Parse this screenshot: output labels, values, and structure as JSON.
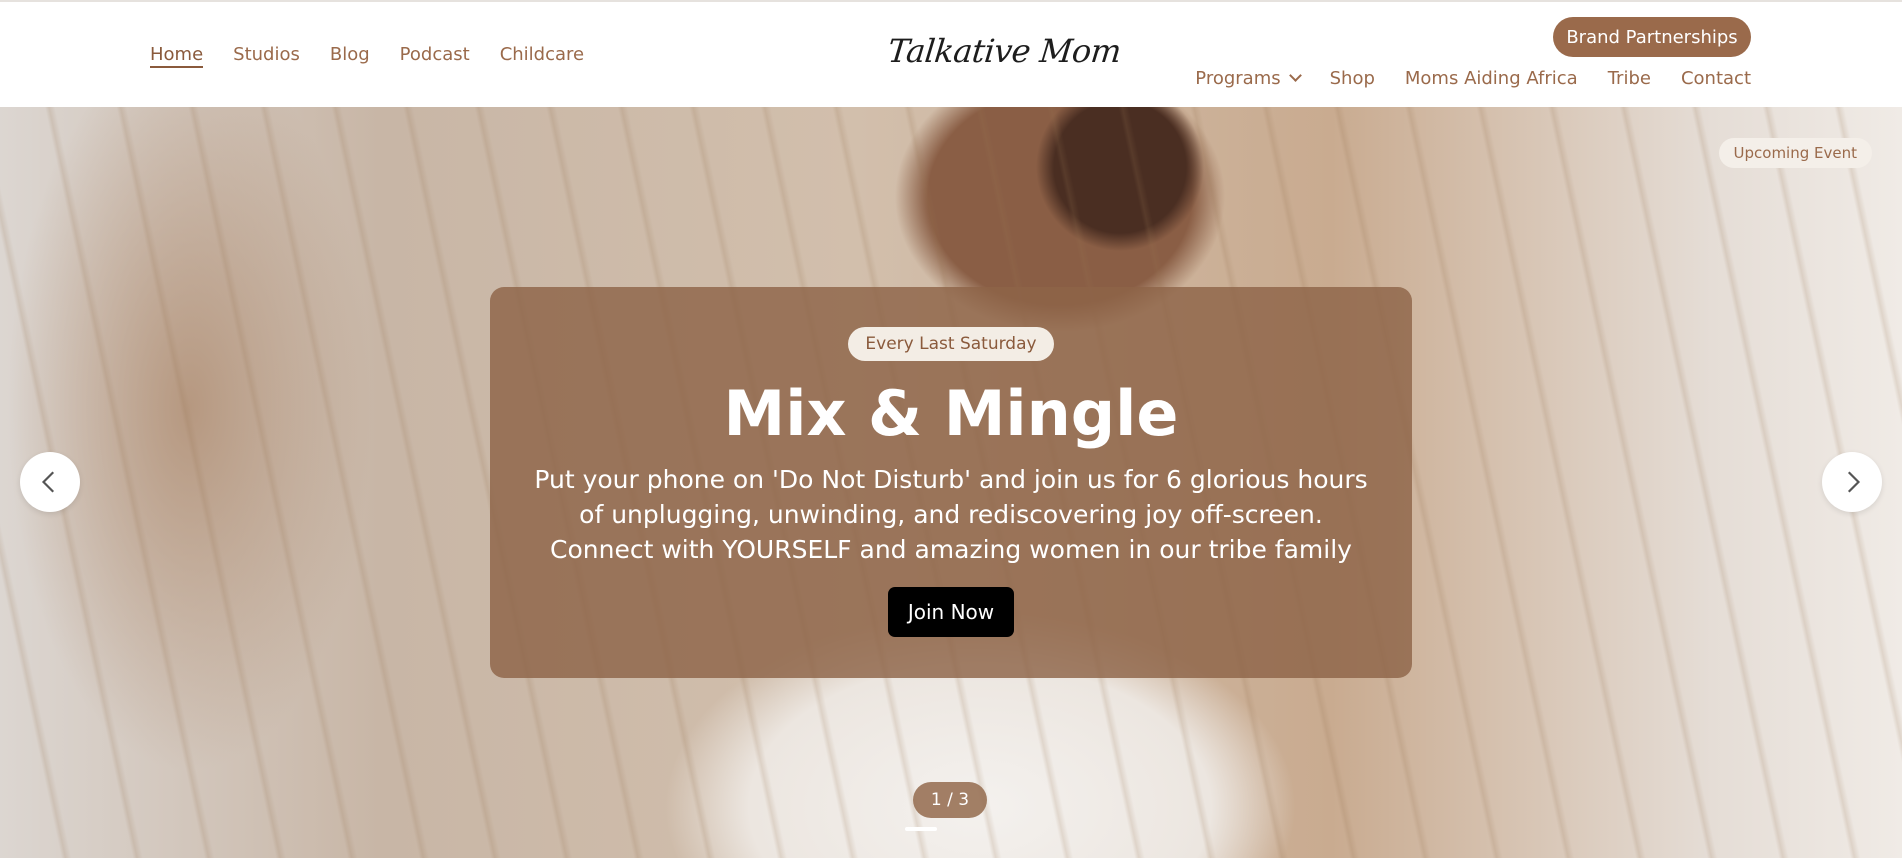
{
  "header": {
    "nav_left": [
      "Home",
      "Studios",
      "Blog",
      "Podcast",
      "Childcare"
    ],
    "logo": "Talkative Mom",
    "brand_button": "Brand Partnerships",
    "nav_right": {
      "programs": "Programs",
      "shop": "Shop",
      "moms_aiding_africa": "Moms Aiding Africa",
      "tribe": "Tribe",
      "contact": "Contact"
    }
  },
  "hero": {
    "upcoming_badge": "Upcoming Event",
    "pill": "Every Last Saturday",
    "title": "Mix & Mingle",
    "description": "Put your phone on 'Do Not Disturb' and join us for 6 glorious hours of unplugging, unwinding, and rediscovering joy off-screen. Connect with YOURSELF and amazing women in our tribe family",
    "cta": "Join Now",
    "counter": "1 / 3",
    "active_slide": 1,
    "total_slides": 3
  },
  "colors": {
    "brand": "#9a6a4b",
    "card": "#8d6448",
    "cta": "#000000"
  }
}
